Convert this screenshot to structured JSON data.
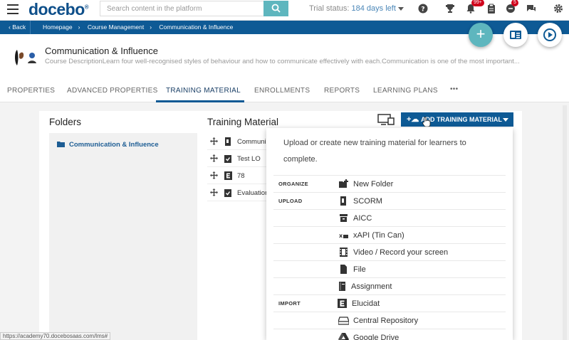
{
  "topbar": {
    "logo": "docebo",
    "logo_mark": "®",
    "search_placeholder": "Search content in the platform",
    "trial_label": "Trial status:",
    "trial_value": "184 days left",
    "notifications_badge": "99+",
    "messages_badge": "5"
  },
  "breadcrumb": {
    "back": "Back",
    "items": [
      "Homepage",
      "Course Management",
      "Communication & Influence"
    ]
  },
  "course": {
    "title": "Communication & Influence",
    "description": "Course DescriptionLearn four well-recognised styles of behaviour and how to communicate effectively with each.Communication is one of the most important..."
  },
  "tabs": [
    "PROPERTIES",
    "ADVANCED PROPERTIES",
    "TRAINING MATERIAL",
    "ENROLLMENTS",
    "REPORTS",
    "LEARNING PLANS",
    "•••"
  ],
  "folders": {
    "heading": "Folders",
    "items": [
      "Communication & Influence"
    ]
  },
  "training_material": {
    "heading": "Training Material",
    "add_button": "ADD TRAINING MATERIAL",
    "items": [
      {
        "name": "Communi",
        "icon": "scorm-icon"
      },
      {
        "name": "Test LO",
        "icon": "test-icon"
      },
      {
        "name": "78",
        "icon": "elucidat-icon"
      },
      {
        "name": "Evaluation",
        "icon": "test-icon"
      }
    ]
  },
  "menu": {
    "intro": "Upload or create new training material for learners to complete.",
    "rows": [
      {
        "section": "ORGANIZE",
        "label": "New Folder",
        "icon": "new-folder-icon"
      },
      {
        "section": "UPLOAD",
        "label": "SCORM",
        "icon": "scorm-icon"
      },
      {
        "section": "",
        "label": "AICC",
        "icon": "aicc-icon"
      },
      {
        "section": "",
        "label": "xAPI (Tin Can)",
        "icon": "xapi-icon"
      },
      {
        "section": "",
        "label": "Video / Record your screen",
        "icon": "video-icon"
      },
      {
        "section": "",
        "label": "File",
        "icon": "file-icon"
      },
      {
        "section": "",
        "label": "Assignment",
        "icon": "assignment-icon"
      },
      {
        "section": "IMPORT",
        "label": "Elucidat",
        "icon": "elucidat-icon"
      },
      {
        "section": "",
        "label": "Central Repository",
        "icon": "central-repository-icon"
      },
      {
        "section": "",
        "label": "Google Drive",
        "icon": "google-drive-icon"
      }
    ]
  },
  "status_url": "https://academy70.docebosaas.com/lms#",
  "colors": {
    "brand": "#0e5a95",
    "accent": "#5eb6be",
    "badge": "#d0021b"
  }
}
